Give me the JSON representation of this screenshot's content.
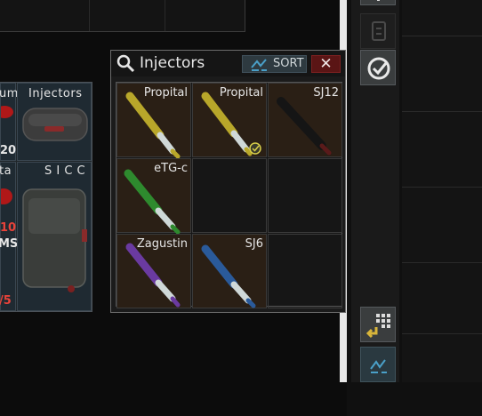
{
  "window": {
    "title": "Injectors",
    "sort_label": "SORT",
    "close_label": "✕"
  },
  "slots": [
    {
      "name": "Propital",
      "color": "#b8a72a"
    },
    {
      "name": "Propital",
      "color": "#b8a72a",
      "checked": true
    },
    {
      "name": "SJ12",
      "color": "#1c1c1c"
    },
    {
      "name": "eTG-c",
      "color": "#2e8a2e"
    },
    {
      "name": "Zagustin",
      "color": "#6a3aa0"
    },
    {
      "name": "SJ6",
      "color": "#2a5a9a"
    }
  ],
  "left_panel": {
    "tl_name": "um",
    "tr_name": "Injectors",
    "tl_count": "20",
    "bl_name": "ta",
    "br_name": "S I C C",
    "bl_red": "10",
    "bl_ms": "MS",
    "bl_frac": "/5"
  }
}
